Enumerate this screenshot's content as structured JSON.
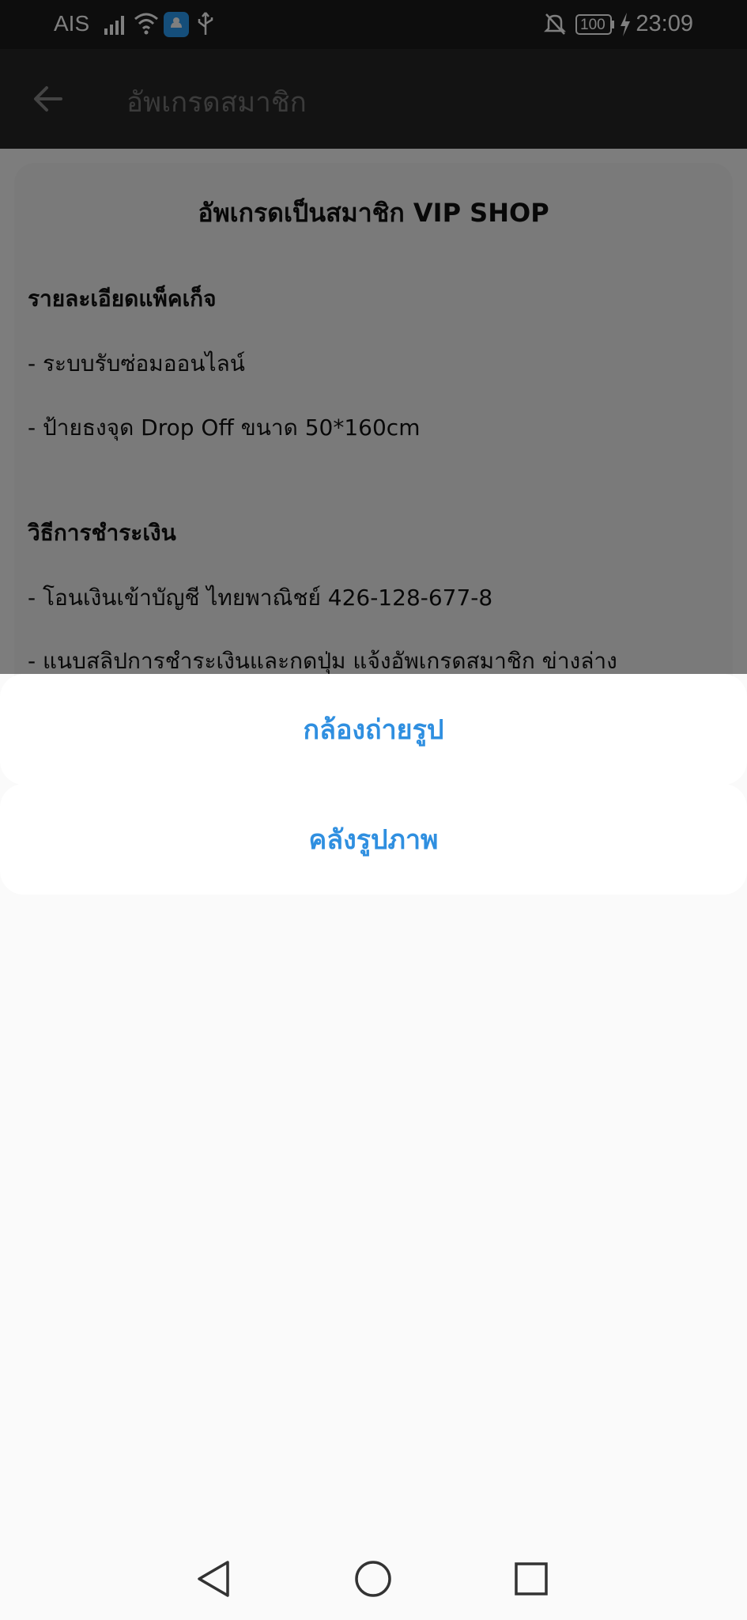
{
  "status_bar": {
    "carrier": "AIS",
    "battery": "100",
    "time": "23:09"
  },
  "app_bar": {
    "title": "อัพเกรดสมาชิก"
  },
  "card": {
    "title": "อัพเกรดเป็นสมาชิก VIP SHOP",
    "package_heading": "รายละเอียดแพ็คเก็จ",
    "package_items": [
      "- ระบบรับซ่อมออนไลน์",
      "- ป้ายธงจุด Drop Off ขนาด 50*160cm"
    ],
    "payment_heading": "วิธีการชำระเงิน",
    "payment_items": [
      "- โอนเงินเข้าบัญชี ไทยพาณิชย์ 426-128-677-8",
      "- แนบสลิปการชำระเงินและกดปุ่ม แจ้งอัพเกรดสมาชิก ข่างล่าง"
    ]
  },
  "action_sheet": {
    "camera_label": "กล้องถ่ายรูป",
    "gallery_label": "คลังรูปภาพ",
    "accent_color": "#2f8fe0"
  },
  "nav_icons": [
    "back-triangle-icon",
    "home-circle-icon",
    "recents-square-icon"
  ]
}
